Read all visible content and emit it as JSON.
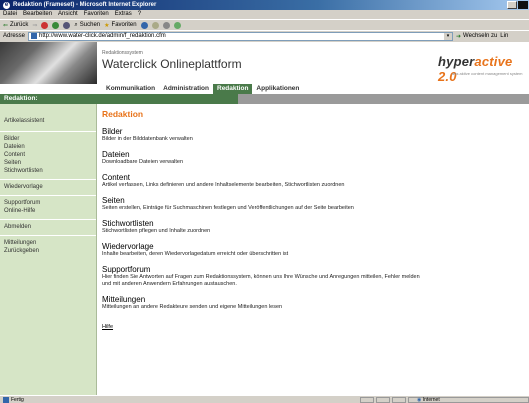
{
  "window": {
    "title": "Redaktion (Frameset) - Microsoft Internet Explorer"
  },
  "menu": [
    "Datei",
    "Bearbeiten",
    "Ansicht",
    "Favoriten",
    "Extras",
    "?"
  ],
  "toolbar": {
    "back": "Zurück",
    "search": "Suchen",
    "favorites": "Favoriten"
  },
  "address": {
    "label": "Adresse",
    "url": "http://www.water-click.de/admin/f_redaktion.cfm",
    "go": "Wechseln zu",
    "links": "Lin"
  },
  "banner": {
    "system_small": "Redaktionssystem",
    "system_title": "Waterclick Onlineplattform",
    "brand_hyper": "hyper",
    "brand_active": "active",
    "brand_version": " 2.0",
    "brand_sub": "das aktive content management system"
  },
  "nav": [
    "Kommunikation",
    "Administration",
    "Redaktion",
    "Applikationen"
  ],
  "nav_active_index": 2,
  "section": {
    "label": "Redaktion:"
  },
  "sidebar": {
    "groups": [
      [
        "Artikelassistent"
      ],
      [
        "Bilder",
        "Dateien",
        "Content",
        "Seiten",
        "Stichwortlisten"
      ],
      [
        "Wiedervorlage"
      ],
      [
        "Supportforum",
        "Online-Hilfe"
      ],
      [
        "Abmelden"
      ],
      [
        "Mitteilungen",
        "Zurückgeben"
      ]
    ]
  },
  "content": {
    "heading": "Redaktion",
    "entries": [
      {
        "title": "Bilder",
        "desc": "Bilder in der Bilddatenbank verwalten"
      },
      {
        "title": "Dateien",
        "desc": "Downloadbare Dateien verwalten"
      },
      {
        "title": "Content",
        "desc": "Artikel verfassen, Links definieren und andere Inhaltselemente bearbeiten, Stichwortlisten zuordnen"
      },
      {
        "title": "Seiten",
        "desc": "Seiten erstellen, Einträge für Suchmaschinen festlegen und Veröffentlichungen auf der Seite bearbeiten"
      },
      {
        "title": "Stichwortlisten",
        "desc": "Stichwortlisten pflegen und Inhalte zuordnen"
      },
      {
        "title": "Wiedervorlage",
        "desc": "Inhalte bearbeiten, deren Wiedervorlagedatum erreicht oder überschritten ist"
      },
      {
        "title": "Supportforum",
        "desc": "Hier finden Sie Antworten auf Fragen zum Redaktionssystem, können uns Ihre Wünsche und Anregungen mitteilen, Fehler melden und mit anderen Anwendern Erfahrungen austauschen."
      },
      {
        "title": "Mitteilungen",
        "desc": "Mitteilungen an andere Redakteure senden und eigene Mitteilungen lesen"
      }
    ],
    "help": "Hilfe"
  },
  "status": {
    "left": "Fertig",
    "zone": "Internet"
  },
  "colors": {
    "accent": "#e8731a",
    "nav_green": "#4a7a4a",
    "sidebar_bg": "#d6e5c6"
  }
}
